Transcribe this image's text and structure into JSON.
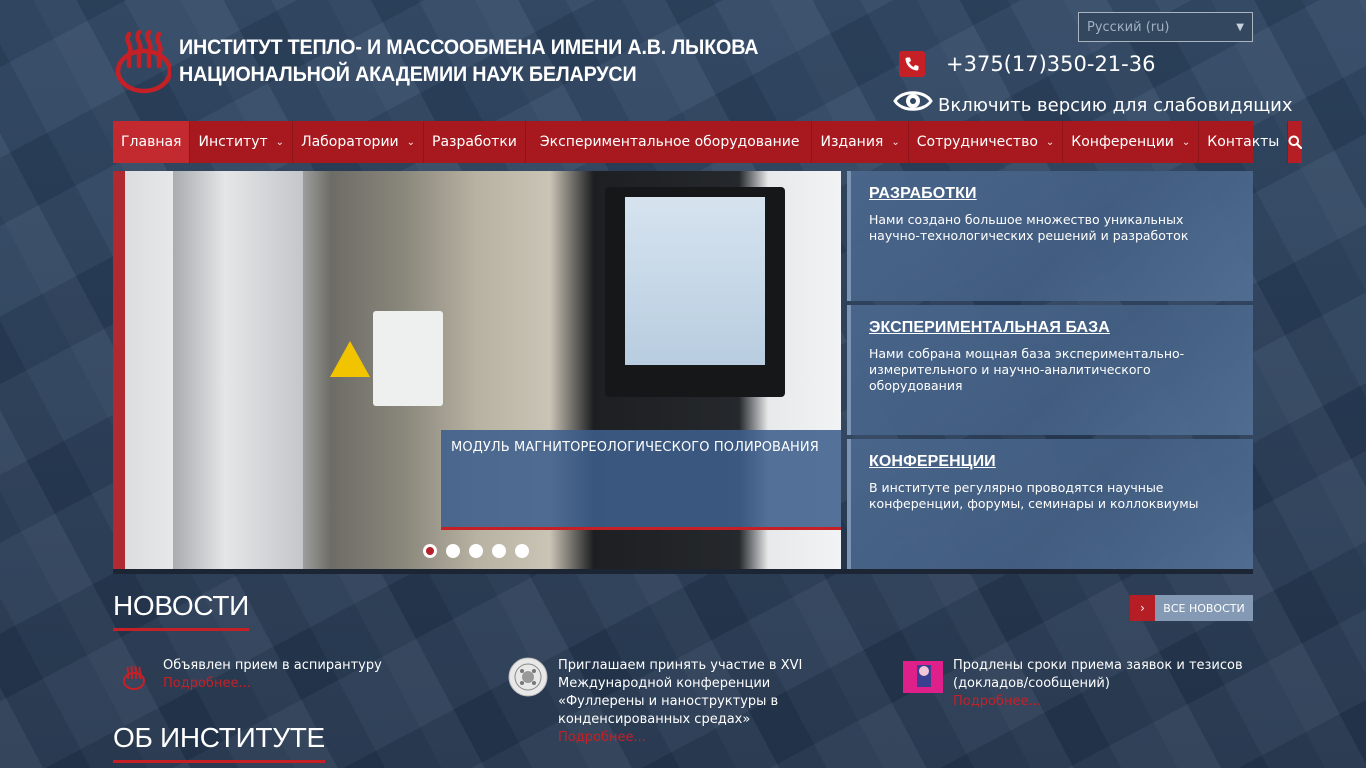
{
  "header": {
    "title_line1": "ИНСТИТУТ ТЕПЛО- И МАССООБМЕНА ИМЕНИ А.В. ЛЫКОВА",
    "title_line2": "НАЦИОНАЛЬНОЙ АКАДЕМИИ НАУК БЕЛАРУСИ",
    "language": "Русский (ru)",
    "phone": "+375(17)350-21-36",
    "accessibility_link": "Включить версию для слабовидящих"
  },
  "nav": {
    "items": [
      {
        "label": "Главная",
        "active": true,
        "dropdown": false
      },
      {
        "label": "Институт",
        "dropdown": true
      },
      {
        "label": "Лаборатории",
        "dropdown": true
      },
      {
        "label": "Разработки",
        "dropdown": false
      },
      {
        "label": "Экспериментальное оборудование",
        "dropdown": false
      },
      {
        "label": "Издания",
        "dropdown": true
      },
      {
        "label": "Сотрудничество",
        "dropdown": true
      },
      {
        "label": "Конференции",
        "dropdown": true
      },
      {
        "label": "Контакты",
        "dropdown": false
      }
    ]
  },
  "slider": {
    "caption": "МОДУЛЬ МАГНИТОРЕОЛОГИЧЕСКОГО ПОЛИРОВАНИЯ",
    "slide_count": 5,
    "active_slide": 1
  },
  "features": [
    {
      "title": "РАЗРАБОТКИ",
      "text": "Нами создано большое множество уникальных научно-технологических решений и разработок"
    },
    {
      "title": "ЭКСПЕРИМЕНТАЛЬНАЯ БАЗА",
      "text": "Нами собрана мощная база экспериментально-измерительного и научно-аналитического оборудования"
    },
    {
      "title": "КОНФЕРЕНЦИИ",
      "text": "В институте регулярно проводятся научные конференции, форумы, семинары и коллоквиумы"
    }
  ],
  "news": {
    "heading": "НОВОСТИ",
    "all_news": "ВСЕ НОВОСТИ",
    "items": [
      {
        "title": "Объявлен прием в аспирантуру",
        "more": "Подробнее..."
      },
      {
        "title": "Приглашаем принять участие в XVI Международной конференции «Фуллерены и наноструктуры в конденсированных средах»",
        "more": "Подробнее..."
      },
      {
        "title": "Продлены сроки приема заявок и тезисов (докладов/сообщений)",
        "more": "Подробнее..."
      }
    ]
  },
  "about": {
    "heading": "ОБ ИНСТИТУТЕ"
  },
  "colors": {
    "brand_red": "#c62027",
    "nav_red": "#a8191f",
    "panel_blue": "#4a678c"
  }
}
